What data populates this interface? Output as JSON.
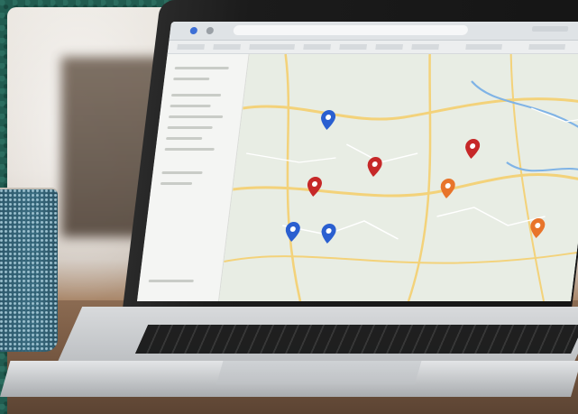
{
  "scene": {
    "colors": {
      "frame": "#215c50",
      "wall": "#e6e1da",
      "table": "#7a5b44",
      "mug": "#3f7388",
      "laptop_bezel": "#1b1b1b"
    },
    "objects": [
      "mug-icon",
      "laptop-icon",
      "map-icon"
    ]
  },
  "screen": {
    "window_title": "",
    "map_pins": [
      {
        "color": "#2a5fd0"
      },
      {
        "color": "#c62828"
      },
      {
        "color": "#c62828"
      },
      {
        "color": "#c62828"
      },
      {
        "color": "#e8742a"
      },
      {
        "color": "#e8742a"
      },
      {
        "color": "#2a5fd0"
      },
      {
        "color": "#2a5fd0"
      }
    ]
  }
}
